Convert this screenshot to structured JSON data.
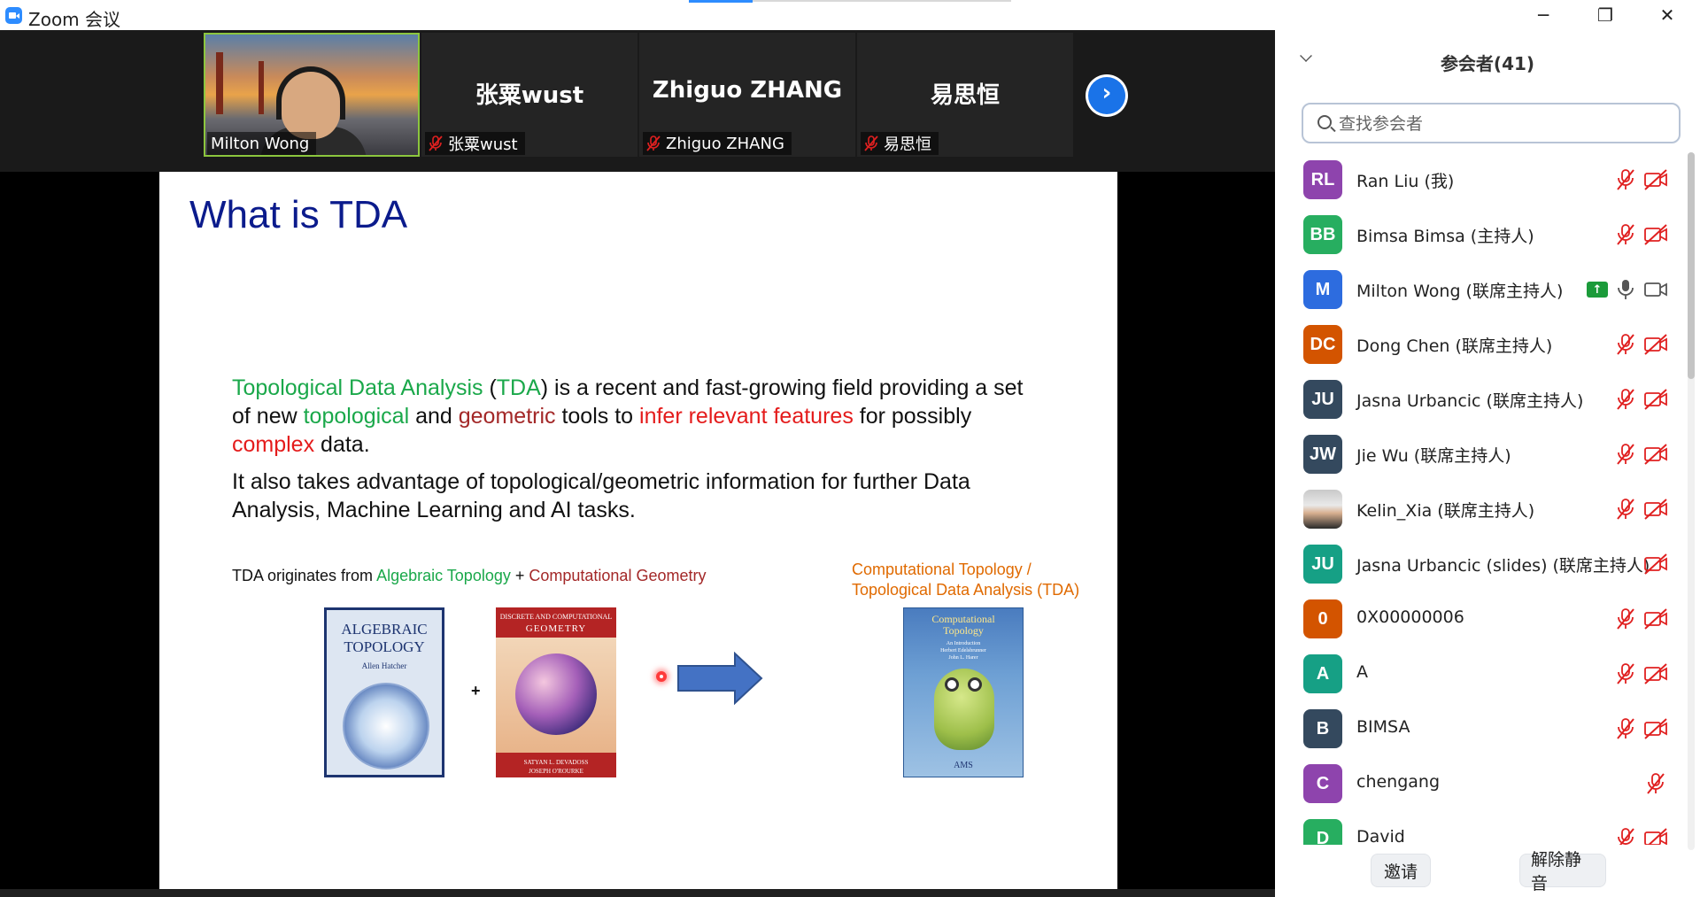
{
  "window": {
    "title": "Zoom 会议",
    "min_icon": "─",
    "max_icon": "❐",
    "close_icon": "✕"
  },
  "video_strip": {
    "tiles": [
      {
        "name": "Milton Wong",
        "active": true,
        "muted": false
      },
      {
        "name": "张粟wust",
        "display": "张粟wust",
        "muted": true
      },
      {
        "name": "Zhiguo ZHANG",
        "display": "Zhiguo ZHANG",
        "muted": true
      },
      {
        "name": "易思恒",
        "display": "易思恒",
        "muted": true
      }
    ],
    "next_icon": "›"
  },
  "slide": {
    "title": "What is TDA",
    "para1": {
      "s1": "Topological Data Analysis",
      "s2": " (",
      "s3": "TDA",
      "s4": ") is a recent and fast-growing field providing a set of new ",
      "s5": "topological",
      "s6": " and ",
      "s7": "geometric",
      "s8": " tools to ",
      "s9": "infer relevant features",
      "s10": " for possibly ",
      "s11": "complex",
      "s12": " data."
    },
    "para2": "It also takes advantage of topological/geometric information for further Data Analysis, Machine Learning and AI tasks.",
    "origin": {
      "prefix": "TDA originates from ",
      "a": "Algebraic Topology",
      "plus": " + ",
      "b": "Computational Geometry"
    },
    "target_caption": [
      "Computational Topology /",
      "Topological Data Analysis (TDA)"
    ],
    "plus_sign": "+",
    "books": {
      "b1_title": [
        "ALGEBRAIC",
        "TOPOLOGY"
      ],
      "b1_author": "Allen Hatcher",
      "b2_top": "DISCRETE AND COMPUTATIONAL",
      "b2_title": "GEOMETRY",
      "b2_authors": [
        "SATYAN L. DEVADOSS",
        "JOSEPH O'ROURKE"
      ],
      "b3_title": [
        "Computational",
        "Topology"
      ],
      "b3_sub": "An Introduction",
      "b3_authors": [
        "Herbert Edelsbrunner",
        "John L. Harer"
      ],
      "b3_pub": "AMS"
    },
    "colors": {
      "green": "#1aa84a",
      "red": "#e41b1b",
      "darkred": "#a32828",
      "title": "#0b1b8c",
      "orange": "#e06a00"
    }
  },
  "participants_panel": {
    "title": "参会者(41)",
    "search_placeholder": "查找参会者",
    "participants": [
      {
        "initials": "RL",
        "name": "Ran Liu (我)",
        "color": "#8e44ad",
        "mic": "muted",
        "cam": "off"
      },
      {
        "initials": "BB",
        "name": "Bimsa Bimsa (主持人)",
        "color": "#27ae60",
        "mic": "muted",
        "cam": "off"
      },
      {
        "initials": "M",
        "name": "Milton Wong (联席主持人)",
        "color": "#2d6cdf",
        "mic": "on",
        "cam": "on",
        "sharing": true
      },
      {
        "initials": "DC",
        "name": "Dong Chen (联席主持人)",
        "color": "#d35400",
        "mic": "muted",
        "cam": "off"
      },
      {
        "initials": "JU",
        "name": "Jasna Urbancic (联席主持人)",
        "color": "#34495e",
        "mic": "muted",
        "cam": "off"
      },
      {
        "initials": "JW",
        "name": "Jie Wu (联席主持人)",
        "color": "#34495e",
        "mic": "muted",
        "cam": "off"
      },
      {
        "initials": "",
        "name": "Kelin_Xia (联席主持人)",
        "color": "#999999",
        "mic": "muted",
        "cam": "off",
        "photo": true
      },
      {
        "initials": "JU",
        "name": "Jasna Urbancic (slides) (联席主持人)",
        "color": "#16a085",
        "mic": "none",
        "cam": "off"
      },
      {
        "initials": "0",
        "name": "0X00000006",
        "color": "#d35400",
        "mic": "muted",
        "cam": "off"
      },
      {
        "initials": "A",
        "name": "A",
        "color": "#16a085",
        "mic": "muted",
        "cam": "off"
      },
      {
        "initials": "B",
        "name": "BIMSA",
        "color": "#34495e",
        "mic": "muted",
        "cam": "off"
      },
      {
        "initials": "C",
        "name": "chengang",
        "color": "#8e44ad",
        "mic": "muted",
        "cam": "none"
      },
      {
        "initials": "D",
        "name": "David",
        "color": "#27ae60",
        "mic": "muted",
        "cam": "off"
      }
    ],
    "invite_label": "邀请",
    "unmute_label": "解除静音"
  }
}
